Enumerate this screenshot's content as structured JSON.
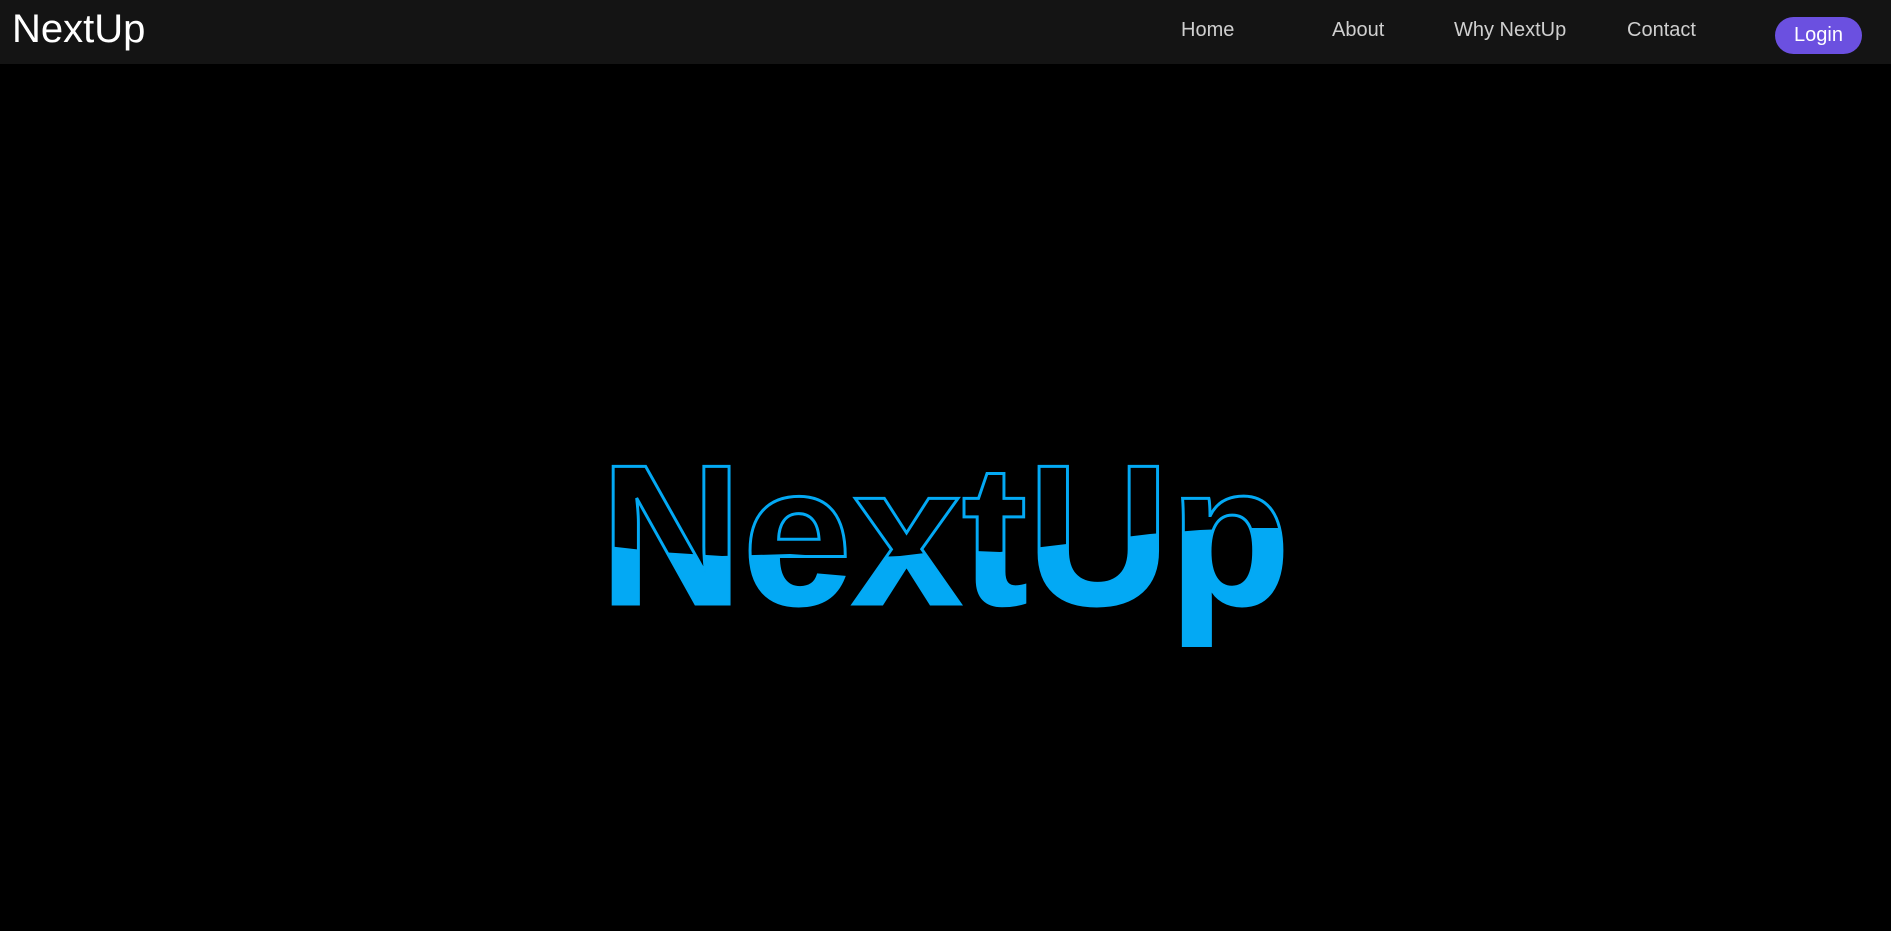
{
  "navbar": {
    "brand": "NextUp",
    "links": {
      "home": "Home",
      "about": "About",
      "why": "Why NextUp",
      "contact": "Contact"
    },
    "login_label": "Login"
  },
  "hero": {
    "title": "NextUp"
  },
  "colors": {
    "accent": "#03a9f4",
    "login": "#6b50e0",
    "nav_bg": "#141414",
    "page_bg": "#000000"
  }
}
